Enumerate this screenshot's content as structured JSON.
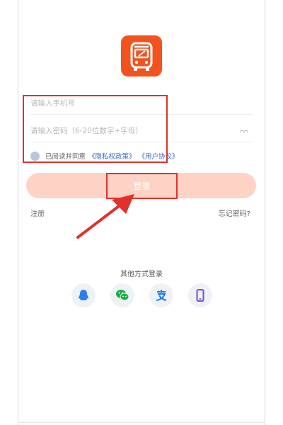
{
  "login": {
    "phone_placeholder": "请输入手机号",
    "password_placeholder": "请输入密码（6-20位数字+字母）",
    "agree_prefix": "已阅读并同意",
    "privacy_link": "《隐私权政策》",
    "terms_link": "《用户协议》",
    "login_button": "登录",
    "register_link": "注册",
    "forgot_link": "忘记密码?"
  },
  "other_login": {
    "label": "其他方式登录",
    "options": [
      {
        "name": "qq-icon"
      },
      {
        "name": "wechat-icon"
      },
      {
        "name": "alipay-icon"
      },
      {
        "name": "phone-icon"
      }
    ]
  },
  "colors": {
    "brand": "#f2531e",
    "button_disabled": "#fdd3c6",
    "annotation_red": "#e0312c",
    "link_blue": "#2f6bd3"
  }
}
